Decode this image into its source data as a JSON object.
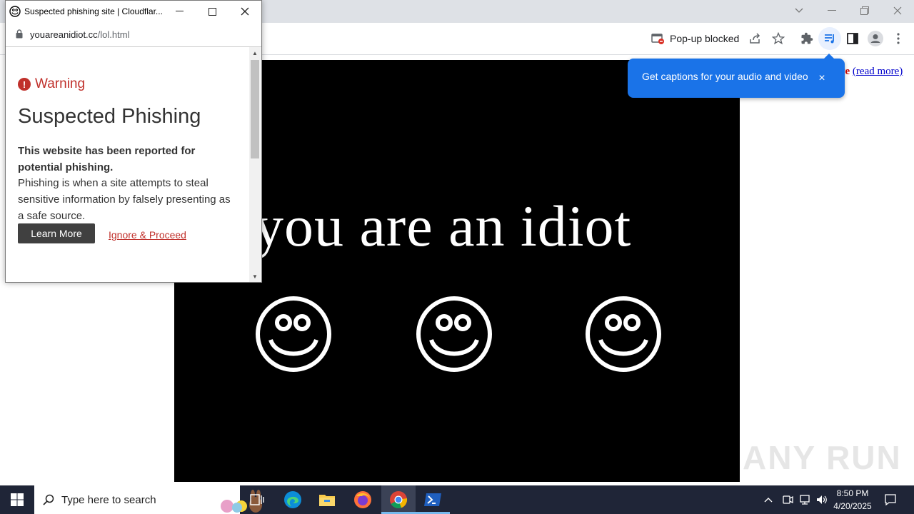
{
  "browser": {
    "popup_blocked_label": "Pop-up blocked",
    "read_more_prefix": "ve",
    "read_more_link": "(read more)"
  },
  "stage": {
    "headline": "you are an idiot",
    "smiley_count": 3
  },
  "captions_tooltip": {
    "text": "Get captions for your audio and video",
    "close": "×"
  },
  "popup": {
    "title": "Suspected phishing site | Cloudflar...",
    "url_host": "youareanidiot.cc",
    "url_path": "/lol.html",
    "warning_label": "Warning",
    "heading": "Suspected Phishing",
    "bold_text": "This website has been reported for potential phishing.",
    "description": "Phishing is when a site attempts to steal sensitive information by falsely presenting as a safe source.",
    "learn_more": "Learn More",
    "ignore_proceed": "Ignore & Proceed"
  },
  "watermark": "ANY RUN",
  "taskbar": {
    "search_placeholder": "Type here to search",
    "time": "8:50 PM",
    "date": "4/20/2025"
  },
  "colors": {
    "warning_red": "#c0302b",
    "tooltip_blue": "#1a73e8",
    "taskbar_bg": "#1f2537"
  }
}
